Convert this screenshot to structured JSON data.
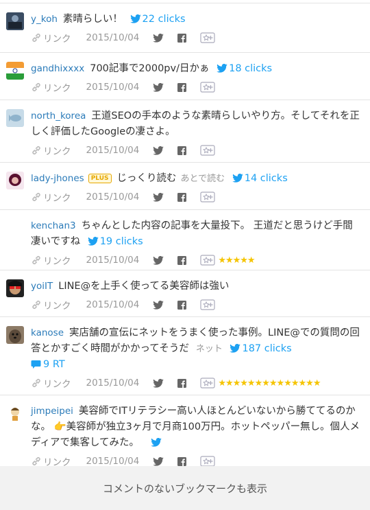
{
  "link_label": "リンク",
  "items": [
    {
      "user": "y_koh",
      "comment": "素晴らしい！",
      "clicks": "22 clicks",
      "date": "2015/10/04"
    },
    {
      "user": "gandhixxxx",
      "comment": "700記事で2000pv/日かぁ",
      "clicks": "18 clicks",
      "date": "2015/10/04"
    },
    {
      "user": "north_korea",
      "comment": "王道SEOの手本のような素晴らしいやり方。そしてそれを正しく評価したGoogleの凄さよ。",
      "date": "2015/10/04"
    },
    {
      "user": "lady-jhones",
      "badge": "PLUS",
      "comment": "じっくり読む",
      "tag": "あとで読む",
      "clicks": "14 clicks",
      "date": "2015/10/04"
    },
    {
      "user": "kenchan3",
      "comment": "ちゃんとした内容の記事を大量投下。 王道だと思うけど手間凄いですね",
      "clicks": "19 clicks",
      "date": "2015/10/04",
      "stars": "★★★★★"
    },
    {
      "user": "yoiIT",
      "comment": "LINE@を上手く使ってる美容師は強い",
      "date": "2015/10/04"
    },
    {
      "user": "kanose",
      "comment": "実店舗の宣伝にネットをうまく使った事例。LINE@での質問の回答とかすごく時間がかかってそうだ",
      "tag": "ネット",
      "clicks": "187 clicks",
      "rt": "9 RT",
      "date": "2015/10/04",
      "stars": "★★★★★★★★★★★★★★"
    },
    {
      "user": "jimpeipei",
      "comment": "美容師でITリテラシー高い人ほとんどいないから勝ててるのかな。 👉美容師が独立3ヶ月で月商100万円。ホットペッパー無し。個人メディアで集客してみた。",
      "date": "2015/10/04"
    }
  ],
  "footer_label": "コメントのないブックマークも表示"
}
